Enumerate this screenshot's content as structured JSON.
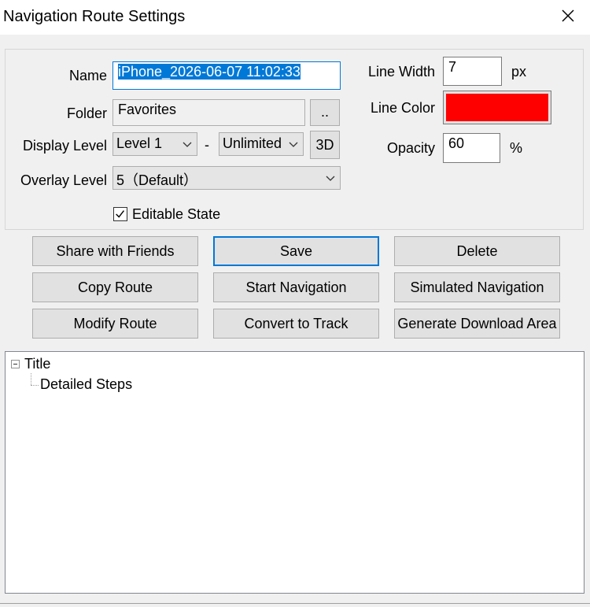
{
  "window": {
    "title": "Navigation Route Settings"
  },
  "form": {
    "name_label": "Name",
    "name_value": "iPhone_2026-06-07 11:02:33",
    "folder_label": "Folder",
    "folder_value": "Favorites",
    "folder_browse_label": "..",
    "display_level_label": "Display Level",
    "display_level_from": "Level 1",
    "display_level_separator": "-",
    "display_level_to": "Unlimited",
    "btn_3d_label": "3D",
    "overlay_level_label": "Overlay Level",
    "overlay_level_value": "5（Default）",
    "editable_label": "Editable State",
    "editable_checked": true,
    "line_width_label": "Line Width",
    "line_width_value": "7",
    "line_width_unit": "px",
    "line_color_label": "Line Color",
    "line_color_value": "#ff0000",
    "opacity_label": "Opacity",
    "opacity_value": "60",
    "opacity_unit": "%"
  },
  "buttons": {
    "share": "Share with Friends",
    "save": "Save",
    "delete": "Delete",
    "copy_route": "Copy Route",
    "start_navigation": "Start Navigation",
    "simulated_navigation": "Simulated Navigation",
    "modify_route": "Modify Route",
    "convert_to_track": "Convert to Track",
    "generate_download_area": "Generate Download Area"
  },
  "tree": {
    "root": "Title",
    "child": "Detailed Steps"
  },
  "colors": {
    "accent": "#0078d7",
    "line_color": "#ff0000"
  }
}
